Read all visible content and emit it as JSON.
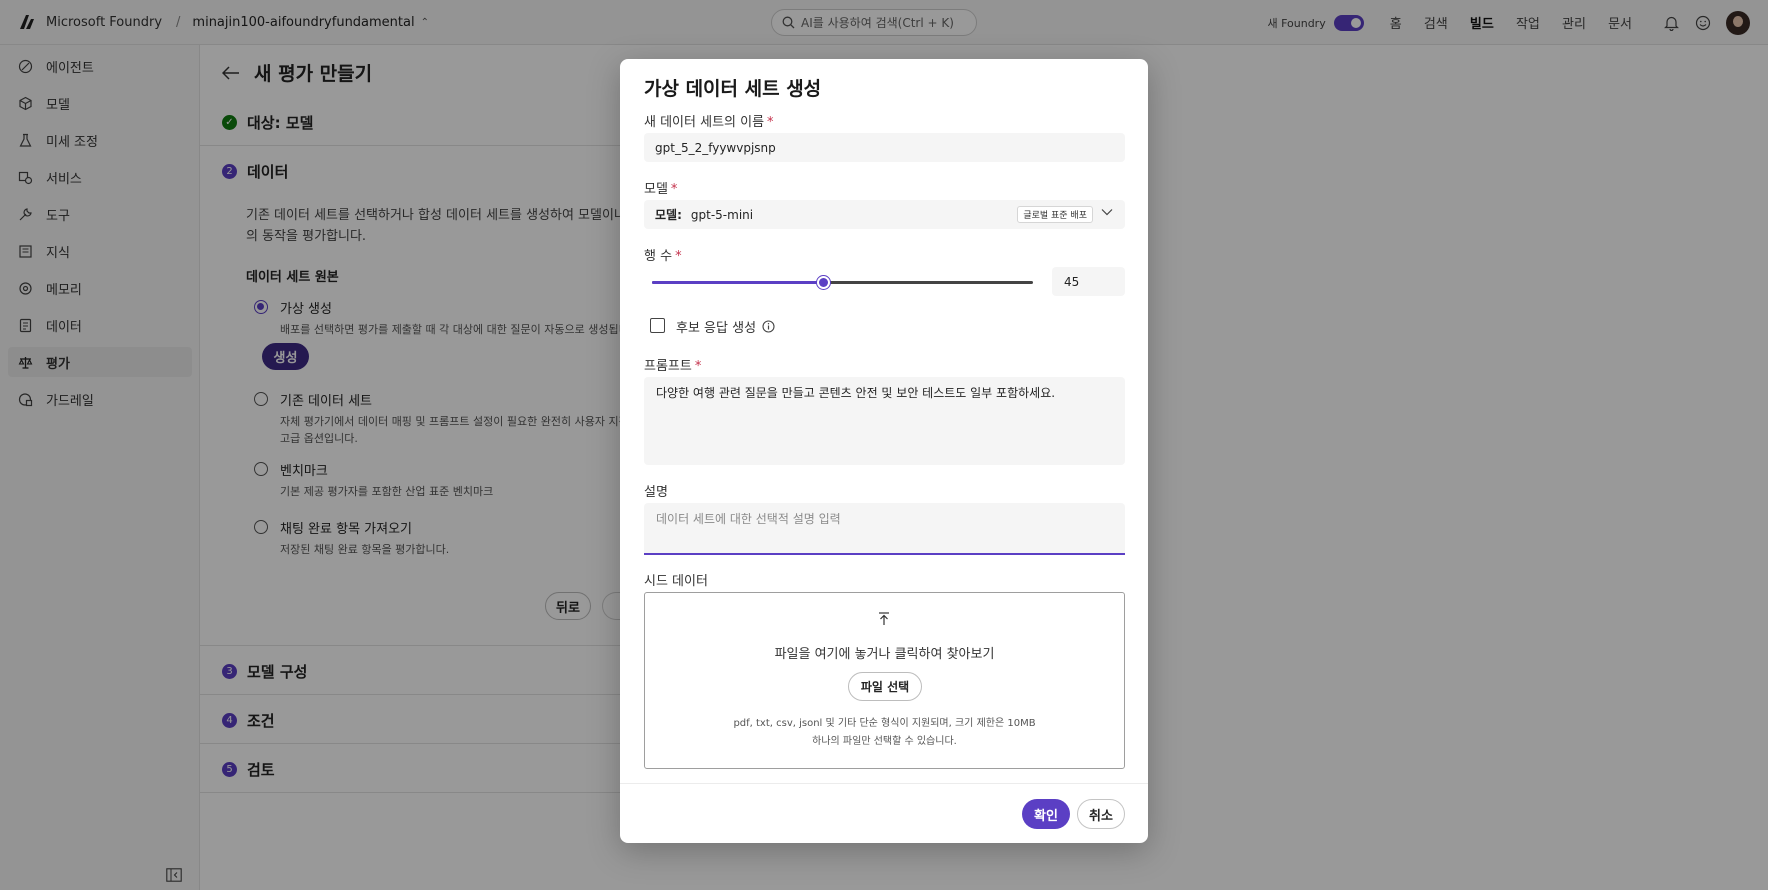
{
  "app": {
    "brand": "Microsoft Foundry",
    "separator": "/",
    "project": "minajin100-aifoundryfundamental",
    "search_placeholder": "AI를 사용하여 검색(Ctrl + K)",
    "new_foundry_label": "새 Foundry",
    "nav": [
      "홈",
      "검색",
      "빌드",
      "작업",
      "관리",
      "문서"
    ]
  },
  "sidebar": {
    "items": [
      {
        "label": "에이전트",
        "icon": "agent-icon"
      },
      {
        "label": "모델",
        "icon": "model-cube-icon"
      },
      {
        "label": "미세 조정",
        "icon": "beaker-icon"
      },
      {
        "label": "서비스",
        "icon": "services-icon"
      },
      {
        "label": "도구",
        "icon": "wrench-icon"
      },
      {
        "label": "지식",
        "icon": "knowledge-icon"
      },
      {
        "label": "메모리",
        "icon": "memory-icon"
      },
      {
        "label": "데이터",
        "icon": "data-icon"
      },
      {
        "label": "평가",
        "icon": "scale-icon"
      },
      {
        "label": "가드레일",
        "icon": "shield-icon"
      }
    ],
    "active_index": 8
  },
  "page": {
    "title": "새 평가 만들기",
    "steps": [
      {
        "num": "✓",
        "label": "대상: 모델"
      },
      {
        "num": "2",
        "label": "데이터"
      },
      {
        "num": "3",
        "label": "모델 구성"
      },
      {
        "num": "4",
        "label": "조건"
      },
      {
        "num": "5",
        "label": "검토"
      }
    ],
    "data_desc_line1": "기존 데이터 세트를 선택하거나 합성 데이터 세트를 생성하여 모델이나 에",
    "data_desc_line2": "의 동작을 평가합니다.",
    "source_title": "데이터 세트 원본",
    "options": [
      {
        "label": "가상 생성",
        "desc1": "배포를 선택하면 평가를 제출할 때 각 대상에 대한 질문이 자동으로 생성됩니",
        "desc2": ""
      },
      {
        "label": "기존 데이터 세트",
        "desc1": "자체 평가기에서 데이터 매핑 및 프롬프트 설정이 필요한 완전히 사용자 지정",
        "desc2": "고급 옵션입니다."
      },
      {
        "label": "벤치마크",
        "desc1": "기본 제공 평가자를 포함한 산업 표준 벤치마크",
        "desc2": ""
      },
      {
        "label": "채팅 완료 항목 가져오기",
        "desc1": "저장된 채팅 완료 항목을 평가합니다.",
        "desc2": ""
      }
    ],
    "generate_button": "생성",
    "back_button": "뒤로"
  },
  "modal": {
    "title": "가상 데이터 세트 생성",
    "name_label": "새 데이터 세트의 이름",
    "name_value": "gpt_5_2_fyywvpjsnp",
    "model_label": "모델",
    "model_key": "모델:",
    "model_value": "gpt-5-mini",
    "model_badge": "글로벌 표준 배포",
    "rows_label": "행 수",
    "rows_value": "45",
    "rows_slider_fraction": 0.45,
    "candidate_label": "후보 응답 생성",
    "candidate_checked": false,
    "prompt_label": "프롬프트",
    "prompt_value": "다양한 여행 관련 질문을 만들고 콘텐츠 안전 및 보안 테스트도 일부 포함하세요.",
    "desc_label": "설명",
    "desc_placeholder": "데이터 세트에 대한 선택적 설명 입력",
    "seed_label": "시드 데이터",
    "drop_text": "파일을 여기에 놓거나 클릭하여 찾아보기",
    "select_file": "파일 선택",
    "hint1": "pdf, txt, csv, jsonl 및 기타 단순 형식이 지원되며, 크기 제한은 10MB",
    "hint2": "하나의 파일만 선택할 수 있습니다.",
    "confirm": "확인",
    "cancel": "취소",
    "required_mark": "*"
  },
  "colors": {
    "accent": "#5b3fc4",
    "success": "#107c10",
    "required": "#c4314b"
  }
}
